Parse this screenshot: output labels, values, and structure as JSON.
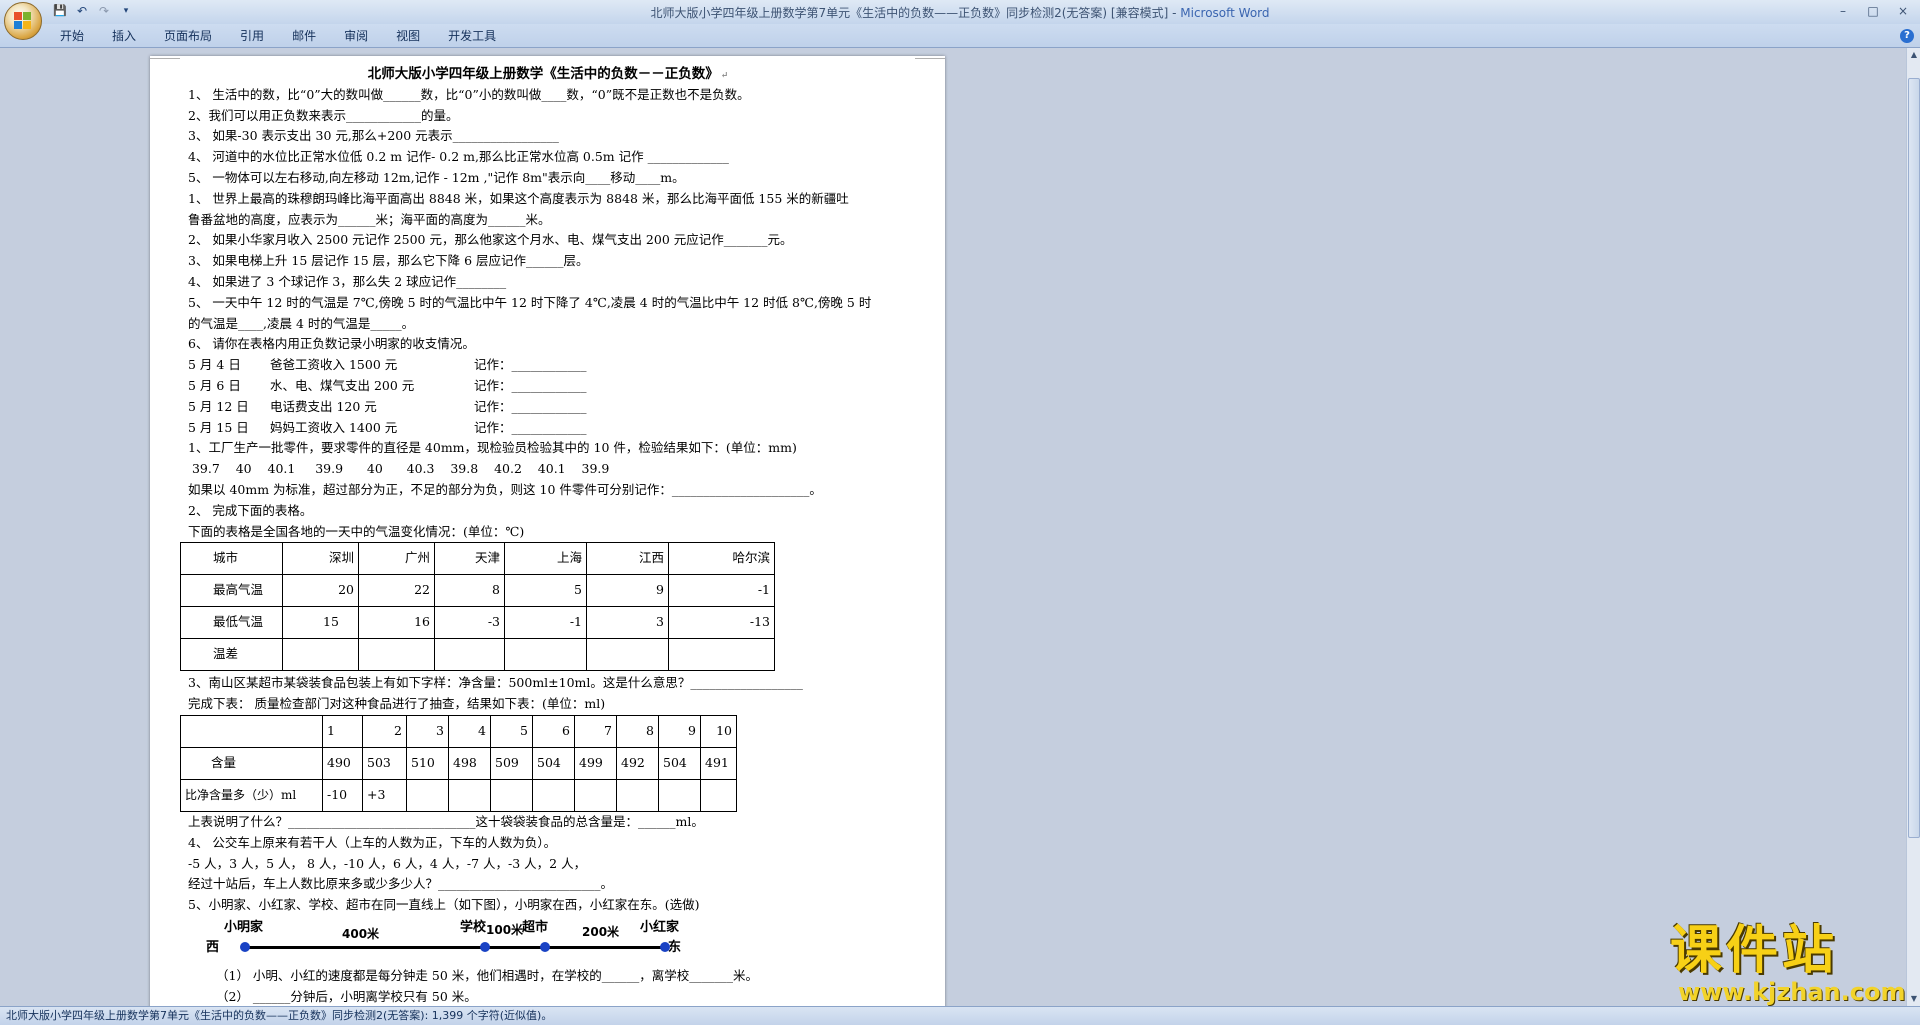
{
  "window": {
    "title": "北师大版小学四年级上册数学第7单元《生活中的负数——正负数》同步检测2(无答案) [兼容模式] - ",
    "app_name": "Microsoft Word",
    "controls": [
      "–",
      "□",
      "×"
    ]
  },
  "quick_access": {
    "save": "💾",
    "undo": "↶",
    "redo": "↷",
    "more": "▾"
  },
  "ribbon": {
    "tabs": [
      "开始",
      "插入",
      "页面布局",
      "引用",
      "邮件",
      "审阅",
      "视图",
      "开发工具"
    ],
    "help": "?"
  },
  "doc": {
    "title": "北师大版小学四年级上册数学《生活中的负数－－正负数》",
    "lines": [
      "1、 生活中的数，比“0”大的数叫做______数，比“0”小的数叫做____数，“0”既不是正数也不是负数。",
      "2、我们可以用正负数来表示____________的量。",
      "3、 如果-30 表示支出 30 元,那么+200 元表示_________________",
      "4、 河道中的水位比正常水位低 0.2 m 记作- 0.2 m,那么比正常水位高 0.5m 记作 _____________",
      "5、 一物体可以左右移动,向左移动 12m,记作 - 12m ,\"记作 8m\"表示向____移动____m。",
      "1、 世界上最高的珠穆朗玛峰比海平面高出 8848 米，如果这个高度表示为 8848 米，那么比海平面低 155 米的新疆吐",
      "鲁番盆地的高度，应表示为______米；海平面的高度为______米。",
      "2、 如果小华家月收入 2500 元记作 2500 元，那么他家这个月水、电、煤气支出 200 元应记作_______元。",
      "3、 如果电梯上升 15 层记作 15 层，那么它下降 6 层应记作______层。",
      "4、 如果进了 3 个球记作 3，那么失 2 球应记作________",
      "5、 一天中午 12 时的气温是 7℃,傍晚 5 时的气温比中午 12 时下降了 4℃,凌晨 4 时的气温比中午 12 时低 8℃,傍晚 5 时",
      "的气温是____,凌晨 4 时的气温是_____。",
      "6、 请你在表格内用正负数记录小明家的收支情况。"
    ],
    "records": [
      {
        "date": "5 月 4 日",
        "item": "爸爸工资收入 1500 元",
        "label": "记作：____________"
      },
      {
        "date": "5 月 6 日",
        "item": "水、电、煤气支出 200 元",
        "label": "记作：____________"
      },
      {
        "date": "5 月 12 日",
        "item": "电话费支出 120 元",
        "label": "记作：____________"
      },
      {
        "date": "5 月 15 日",
        "item": "妈妈工资收入 1400 元",
        "label": "记作：____________"
      }
    ],
    "lines2": [
      "1、工厂生产一批零件，要求零件的直径是 40mm，现检验员检验其中的 10 件，检验结果如下：(单位：mm)",
      " 39.7    40    40.1     39.9      40      40.3    39.8    40.2    40.1    39.9",
      "如果以 40mm 为标准，超过部分为正，不足的部分为负，则这 10 件零件可分别记作：______________________。",
      "2、 完成下面的表格。",
      "下面的表格是全国各地的一天中的气温变化情况：(单位：℃)"
    ],
    "temp_table": {
      "header": [
        "城市",
        "深圳",
        "广州",
        "天津",
        "上海",
        "江西",
        "哈尔滨"
      ],
      "rows": [
        [
          "最高气温",
          "20",
          "22",
          "8",
          "5",
          "9",
          "-1"
        ],
        [
          "最低气温",
          "15",
          "16",
          "-3",
          "-1",
          "3",
          "-13"
        ],
        [
          "温差",
          "",
          "",
          "",
          "",
          "",
          ""
        ]
      ]
    },
    "lines3": [
      "3、南山区某超市某袋装食品包装上有如下字样：净含量：500ml±10ml。这是什么意思？__________________",
      "完成下表：   质量检查部门对这种食品进行了抽查，结果如下表：(单位：ml)"
    ],
    "qc_table": {
      "header": [
        "",
        "1",
        "2",
        "3",
        "4",
        "5",
        "6",
        "7",
        "8",
        "9",
        "10"
      ],
      "rows": [
        [
          "含量",
          "490",
          "503",
          "510",
          "498",
          "509",
          "504",
          "499",
          "492",
          "504",
          "491"
        ],
        [
          "比净含量多（少）ml",
          "-10",
          "+3",
          "",
          "",
          "",
          "",
          "",
          "",
          "",
          ""
        ]
      ]
    },
    "lines4": [
      "上表说明了什么？______________________________这十袋袋装食品的总含量是：______ml。",
      "4、 公交车上原来有若干人（上车的人数为正，下车的人数为负）。",
      "-5 人，3 人，5 人， 8 人，-10 人，6 人，4 人，-7 人，-3 人，2 人，",
      "经过十站后，车上人数比原来多或少多少人？__________________________。",
      "5、小明家、小红家、学校、超市在同一直线上（如下图），小明家在西，小红家在东。(选做)"
    ],
    "diagram": {
      "west": "西",
      "east": "东",
      "xiaoming": "小明家",
      "xiaohong": "小红家",
      "school": "学校",
      "market": "超市",
      "d1": "400米",
      "d2": "100米",
      "d3": "200米"
    },
    "lines5": [
      "（1）    小明、小红的速度都是每分钟走 50 米，他们相遇时，在学校的______，离学校_______米。",
      "（2）    ______分钟后，小明离学校只有 50 米。"
    ]
  },
  "statusbar": {
    "text": "北师大版小学四年级上册数学第7单元《生活中的负数——正负数》同步检测2(无答案): 1,399 个字符(近似值)。"
  },
  "watermark": {
    "big": "课件站",
    "small": "www.kjzhan.com"
  }
}
